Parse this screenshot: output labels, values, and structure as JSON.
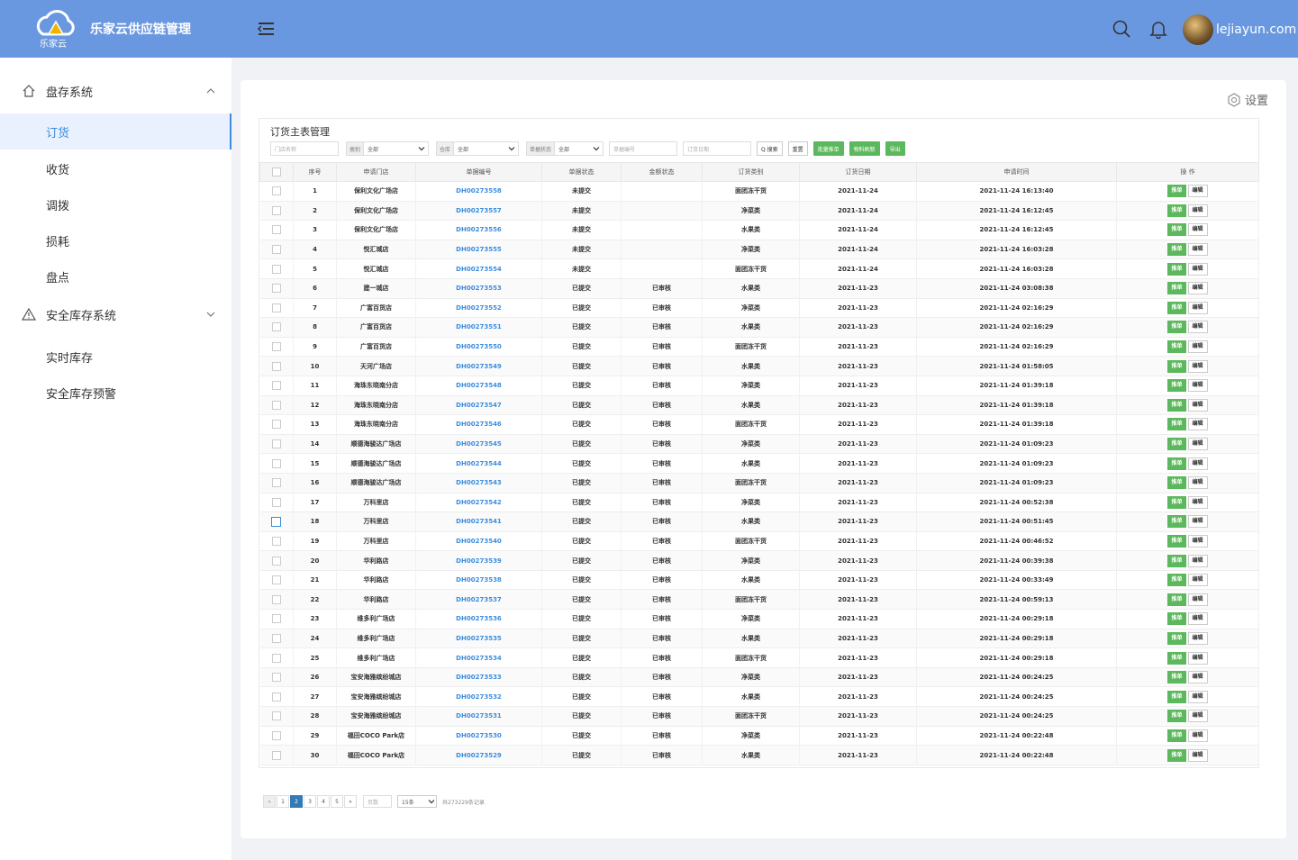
{
  "brand": {
    "title": "乐家云供应链管理",
    "logo_text": "乐家云"
  },
  "header": {
    "username": "lejiayun.com"
  },
  "sidebar": {
    "groups": [
      {
        "label": "盘存系统",
        "items": [
          "订货",
          "收货",
          "调拨",
          "损耗",
          "盘点"
        ]
      },
      {
        "label": "安全库存系统",
        "items": [
          "实时库存",
          "安全库存预警"
        ]
      }
    ],
    "active_item": "订货"
  },
  "main": {
    "settings_label": "设置",
    "panel_title": "订货主表管理",
    "filters": {
      "store_placeholder": "门店名称",
      "category_tag": "类别",
      "category_value": "全部",
      "warehouse_tag": "仓库",
      "warehouse_value": "全部",
      "status_tag": "单据状态",
      "status_value": "全部",
      "order_no_placeholder": "单据编号",
      "date_placeholder": "订货日期",
      "search_label": "Q 搜索",
      "reset_label": "重置",
      "batch_label": "批量推单",
      "refresh_label": "物料刷新",
      "export_label": "导出"
    },
    "table": {
      "columns": [
        "序号",
        "申请门店",
        "单据编号",
        "单据状态",
        "金额状态",
        "订货类别",
        "订货日期",
        "申请时间",
        "操 作"
      ],
      "rows": [
        [
          "1",
          "保利文化广场店",
          "DH00273558",
          "未提交",
          "",
          "面团冻干货",
          "2021-11-24",
          "2021-11-24 16:13:40"
        ],
        [
          "2",
          "保利文化广场店",
          "DH00273557",
          "未提交",
          "",
          "净菜类",
          "2021-11-24",
          "2021-11-24 16:12:45"
        ],
        [
          "3",
          "保利文化广场店",
          "DH00273556",
          "未提交",
          "",
          "水果类",
          "2021-11-24",
          "2021-11-24 16:12:45"
        ],
        [
          "4",
          "悦汇城店",
          "DH00273555",
          "未提交",
          "",
          "净菜类",
          "2021-11-24",
          "2021-11-24 16:03:28"
        ],
        [
          "5",
          "悦汇城店",
          "DH00273554",
          "未提交",
          "",
          "面团冻干货",
          "2021-11-24",
          "2021-11-24 16:03:28"
        ],
        [
          "6",
          "建一城店",
          "DH00273553",
          "已提交",
          "已审核",
          "水果类",
          "2021-11-23",
          "2021-11-24 03:08:38"
        ],
        [
          "7",
          "广富百货店",
          "DH00273552",
          "已提交",
          "已审核",
          "净菜类",
          "2021-11-23",
          "2021-11-24 02:16:29"
        ],
        [
          "8",
          "广富百货店",
          "DH00273551",
          "已提交",
          "已审核",
          "水果类",
          "2021-11-23",
          "2021-11-24 02:16:29"
        ],
        [
          "9",
          "广富百货店",
          "DH00273550",
          "已提交",
          "已审核",
          "面团冻干货",
          "2021-11-23",
          "2021-11-24 02:16:29"
        ],
        [
          "10",
          "天河广场店",
          "DH00273549",
          "已提交",
          "已审核",
          "水果类",
          "2021-11-23",
          "2021-11-24 01:58:05"
        ],
        [
          "11",
          "海珠东晓南分店",
          "DH00273548",
          "已提交",
          "已审核",
          "净菜类",
          "2021-11-23",
          "2021-11-24 01:39:18"
        ],
        [
          "12",
          "海珠东晓南分店",
          "DH00273547",
          "已提交",
          "已审核",
          "水果类",
          "2021-11-23",
          "2021-11-24 01:39:18"
        ],
        [
          "13",
          "海珠东晓南分店",
          "DH00273546",
          "已提交",
          "已审核",
          "面团冻干货",
          "2021-11-23",
          "2021-11-24 01:39:18"
        ],
        [
          "14",
          "顺德海骏达广场店",
          "DH00273545",
          "已提交",
          "已审核",
          "净菜类",
          "2021-11-23",
          "2021-11-24 01:09:23"
        ],
        [
          "15",
          "顺德海骏达广场店",
          "DH00273544",
          "已提交",
          "已审核",
          "水果类",
          "2021-11-23",
          "2021-11-24 01:09:23"
        ],
        [
          "16",
          "顺德海骏达广场店",
          "DH00273543",
          "已提交",
          "已审核",
          "面团冻干货",
          "2021-11-23",
          "2021-11-24 01:09:23"
        ],
        [
          "17",
          "万科里店",
          "DH00273542",
          "已提交",
          "已审核",
          "净菜类",
          "2021-11-23",
          "2021-11-24 00:52:38"
        ],
        [
          "18",
          "万科里店",
          "DH00273541",
          "已提交",
          "已审核",
          "水果类",
          "2021-11-23",
          "2021-11-24 00:51:45"
        ],
        [
          "19",
          "万科里店",
          "DH00273540",
          "已提交",
          "已审核",
          "面团冻干货",
          "2021-11-23",
          "2021-11-24 00:46:52"
        ],
        [
          "20",
          "华利路店",
          "DH00273539",
          "已提交",
          "已审核",
          "净菜类",
          "2021-11-23",
          "2021-11-24 00:39:38"
        ],
        [
          "21",
          "华利路店",
          "DH00273538",
          "已提交",
          "已审核",
          "水果类",
          "2021-11-23",
          "2021-11-24 00:33:49"
        ],
        [
          "22",
          "华利路店",
          "DH00273537",
          "已提交",
          "已审核",
          "面团冻干货",
          "2021-11-23",
          "2021-11-24 00:59:13"
        ],
        [
          "23",
          "维多利广场店",
          "DH00273536",
          "已提交",
          "已审核",
          "净菜类",
          "2021-11-23",
          "2021-11-24 00:29:18"
        ],
        [
          "24",
          "维多利广场店",
          "DH00273535",
          "已提交",
          "已审核",
          "水果类",
          "2021-11-23",
          "2021-11-24 00:29:18"
        ],
        [
          "25",
          "维多利广场店",
          "DH00273534",
          "已提交",
          "已审核",
          "面团冻干货",
          "2021-11-23",
          "2021-11-24 00:29:18"
        ],
        [
          "26",
          "宝安海雅缤纷城店",
          "DH00273533",
          "已提交",
          "已审核",
          "净菜类",
          "2021-11-23",
          "2021-11-24 00:24:25"
        ],
        [
          "27",
          "宝安海雅缤纷城店",
          "DH00273532",
          "已提交",
          "已审核",
          "水果类",
          "2021-11-23",
          "2021-11-24 00:24:25"
        ],
        [
          "28",
          "宝安海雅缤纷城店",
          "DH00273531",
          "已提交",
          "已审核",
          "面团冻干货",
          "2021-11-23",
          "2021-11-24 00:24:25"
        ],
        [
          "29",
          "福田COCO Park店",
          "DH00273530",
          "已提交",
          "已审核",
          "净菜类",
          "2021-11-23",
          "2021-11-24 00:22:48"
        ],
        [
          "30",
          "福田COCO Park店",
          "DH00273529",
          "已提交",
          "已审核",
          "水果类",
          "2021-11-23",
          "2021-11-24 00:22:48"
        ]
      ],
      "action_push": "推单",
      "action_edit": "编辑"
    },
    "pagination": {
      "prev": "«",
      "pages": [
        "1",
        "2",
        "3",
        "4",
        "5"
      ],
      "current": "2",
      "next": "»",
      "jump_placeholder": "页数",
      "page_size": "15条",
      "total": "共273229条记录"
    }
  }
}
